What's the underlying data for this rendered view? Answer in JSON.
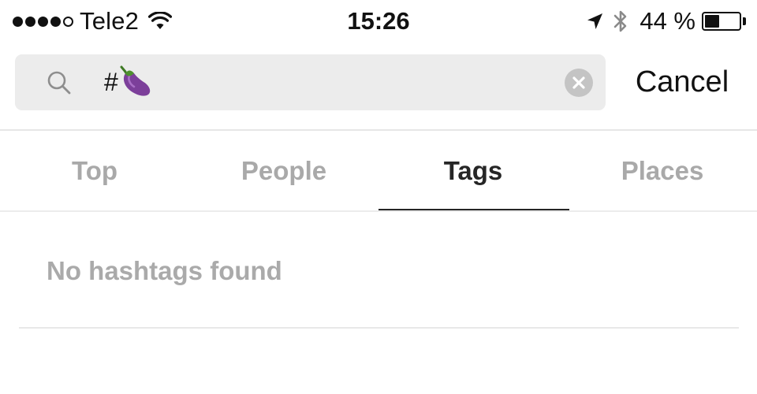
{
  "status_bar": {
    "signal_bars_filled": 4,
    "signal_bars_total": 5,
    "carrier": "Tele2",
    "time": "15:26",
    "battery_percent_text": "44 %",
    "battery_level": 0.44,
    "icons": [
      "wifi-icon",
      "location-arrow-icon",
      "bluetooth-icon",
      "battery-icon"
    ]
  },
  "search": {
    "query_text": "#",
    "query_emoji": "eggplant-emoji",
    "cancel_label": "Cancel"
  },
  "tabs": [
    {
      "label": "Top",
      "active": false
    },
    {
      "label": "People",
      "active": false
    },
    {
      "label": "Tags",
      "active": true
    },
    {
      "label": "Places",
      "active": false
    }
  ],
  "results": {
    "empty_message": "No hashtags found"
  },
  "colors": {
    "search_field_bg": "#ececec",
    "active_tab": "#262626",
    "inactive_tab": "#a9a9a9",
    "empty_text": "#aaaaaa"
  }
}
